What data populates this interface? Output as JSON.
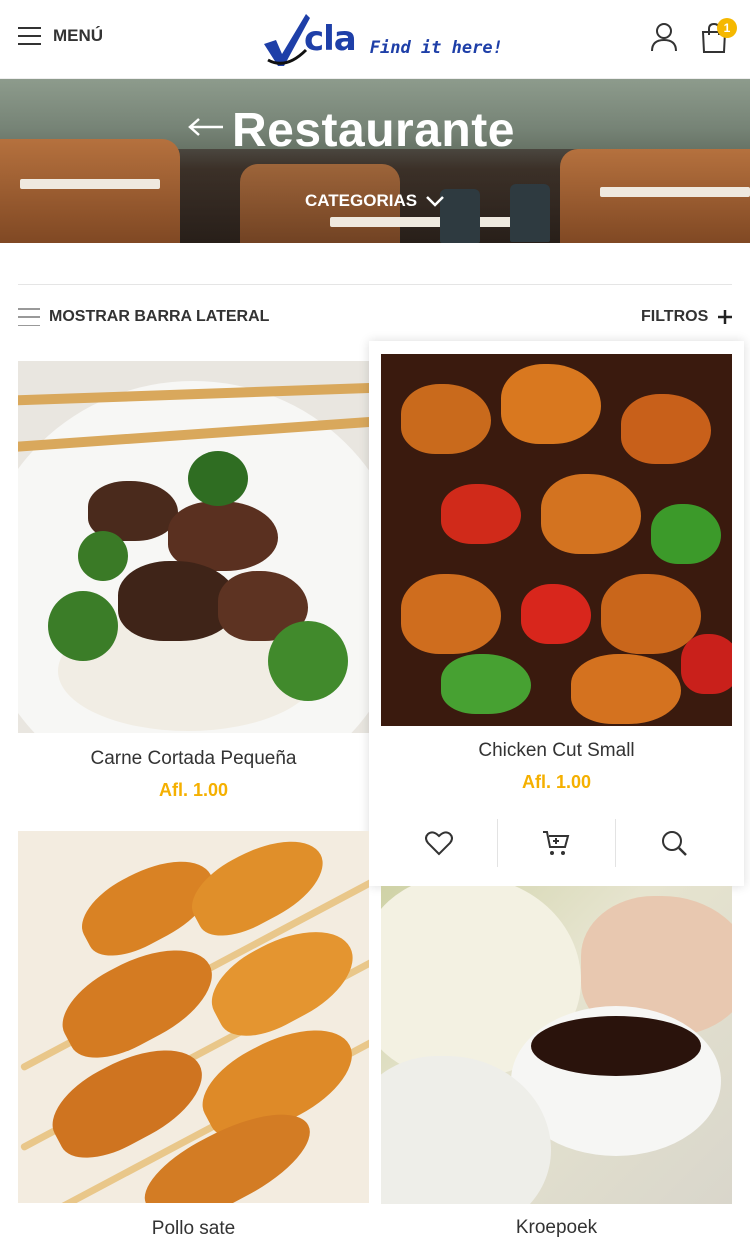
{
  "header": {
    "menu_label": "MENÚ",
    "logo_word": "cla",
    "logo_tagline": "Find it here!",
    "cart_count": "1"
  },
  "hero": {
    "title": "Restaurante",
    "categories_label": "CATEGORIAS"
  },
  "toolbar": {
    "sidebar_label": "MOSTRAR BARRA LATERAL",
    "filters_label": "FILTROS"
  },
  "products": [
    {
      "name": "Carne Cortada Pequeña",
      "price": "Afl. 1.00",
      "image": "beef-broccoli-rice"
    },
    {
      "name": "Chicken Cut Small",
      "price": "Afl. 1.00",
      "image": "kung-pao-chicken"
    },
    {
      "name": "Pollo sate",
      "price": "",
      "image": "chicken-satay-skewers"
    },
    {
      "name": "Kroepoek",
      "price": "",
      "image": "prawn-crackers-sauce"
    }
  ],
  "colors": {
    "accent_price": "#f5b000",
    "badge": "#f5b800",
    "logo_blue": "#1e3fa8"
  }
}
